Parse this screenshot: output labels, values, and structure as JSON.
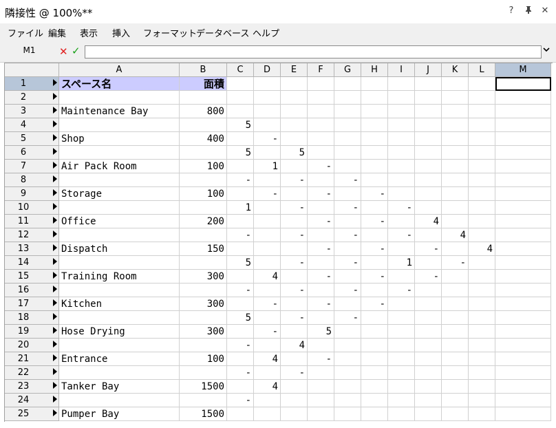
{
  "window": {
    "title": "隣接性 @ 100%**",
    "help": "?",
    "pin": "Ͱ",
    "close": "✕"
  },
  "menu": [
    "ファイル",
    "編集",
    "表示",
    "挿入",
    "フォーマット",
    "データベース",
    "ヘルプ"
  ],
  "formula": {
    "name_box": "M1",
    "value": ""
  },
  "columns": [
    "A",
    "B",
    "C",
    "D",
    "E",
    "F",
    "G",
    "H",
    "I",
    "J",
    "K",
    "L",
    "M"
  ],
  "selected_column": "M",
  "rows": [
    {
      "num": "1",
      "A": "スペース名",
      "B": "面積",
      "cells": {}
    },
    {
      "num": "2",
      "A": "",
      "B": "",
      "cells": {}
    },
    {
      "num": "3",
      "A": "Maintenance Bay",
      "B": "800",
      "cells": {}
    },
    {
      "num": "4",
      "A": "",
      "B": "",
      "cells": {
        "C": "5"
      }
    },
    {
      "num": "5",
      "A": "Shop",
      "B": "400",
      "cells": {
        "D": "-"
      }
    },
    {
      "num": "6",
      "A": "",
      "B": "",
      "cells": {
        "C": "5",
        "E": "5"
      }
    },
    {
      "num": "7",
      "A": "Air Pack Room",
      "B": "100",
      "cells": {
        "D": "1",
        "F": "-"
      }
    },
    {
      "num": "8",
      "A": "",
      "B": "",
      "cells": {
        "C": "-",
        "E": "-",
        "G": "-"
      }
    },
    {
      "num": "9",
      "A": "Storage",
      "B": "100",
      "cells": {
        "D": "-",
        "F": "-",
        "H": "-"
      }
    },
    {
      "num": "10",
      "A": "",
      "B": "",
      "cells": {
        "C": "1",
        "E": "-",
        "G": "-",
        "I": "-"
      }
    },
    {
      "num": "11",
      "A": "Office",
      "B": "200",
      "cells": {
        "F": "-",
        "H": "-",
        "J": "4"
      }
    },
    {
      "num": "12",
      "A": "",
      "B": "",
      "cells": {
        "C": "-",
        "E": "-",
        "G": "-",
        "I": "-",
        "K": "4"
      }
    },
    {
      "num": "13",
      "A": "Dispatch",
      "B": "150",
      "cells": {
        "F": "-",
        "H": "-",
        "J": "-",
        "L": "4"
      }
    },
    {
      "num": "14",
      "A": "",
      "B": "",
      "cells": {
        "C": "5",
        "E": "-",
        "G": "-",
        "I": "1",
        "K": "-"
      }
    },
    {
      "num": "15",
      "A": "Training Room",
      "B": "300",
      "cells": {
        "D": "4",
        "F": "-",
        "H": "-",
        "J": "-"
      }
    },
    {
      "num": "16",
      "A": "",
      "B": "",
      "cells": {
        "C": "-",
        "E": "-",
        "G": "-",
        "I": "-"
      }
    },
    {
      "num": "17",
      "A": "Kitchen",
      "B": "300",
      "cells": {
        "D": "-",
        "F": "-",
        "H": "-"
      }
    },
    {
      "num": "18",
      "A": "",
      "B": "",
      "cells": {
        "C": "5",
        "E": "-",
        "G": "-"
      }
    },
    {
      "num": "19",
      "A": "Hose Drying",
      "B": "300",
      "cells": {
        "D": "-",
        "F": "5"
      }
    },
    {
      "num": "20",
      "A": "",
      "B": "",
      "cells": {
        "C": "-",
        "E": "4"
      }
    },
    {
      "num": "21",
      "A": "Entrance",
      "B": "100",
      "cells": {
        "D": "4",
        "F": "-"
      }
    },
    {
      "num": "22",
      "A": "",
      "B": "",
      "cells": {
        "C": "-",
        "E": "-"
      }
    },
    {
      "num": "23",
      "A": "Tanker Bay",
      "B": "1500",
      "cells": {
        "D": "4"
      }
    },
    {
      "num": "24",
      "A": "",
      "B": "",
      "cells": {
        "C": "-"
      }
    },
    {
      "num": "25",
      "A": "Pumper Bay",
      "B": "1500",
      "cells": {}
    }
  ]
}
